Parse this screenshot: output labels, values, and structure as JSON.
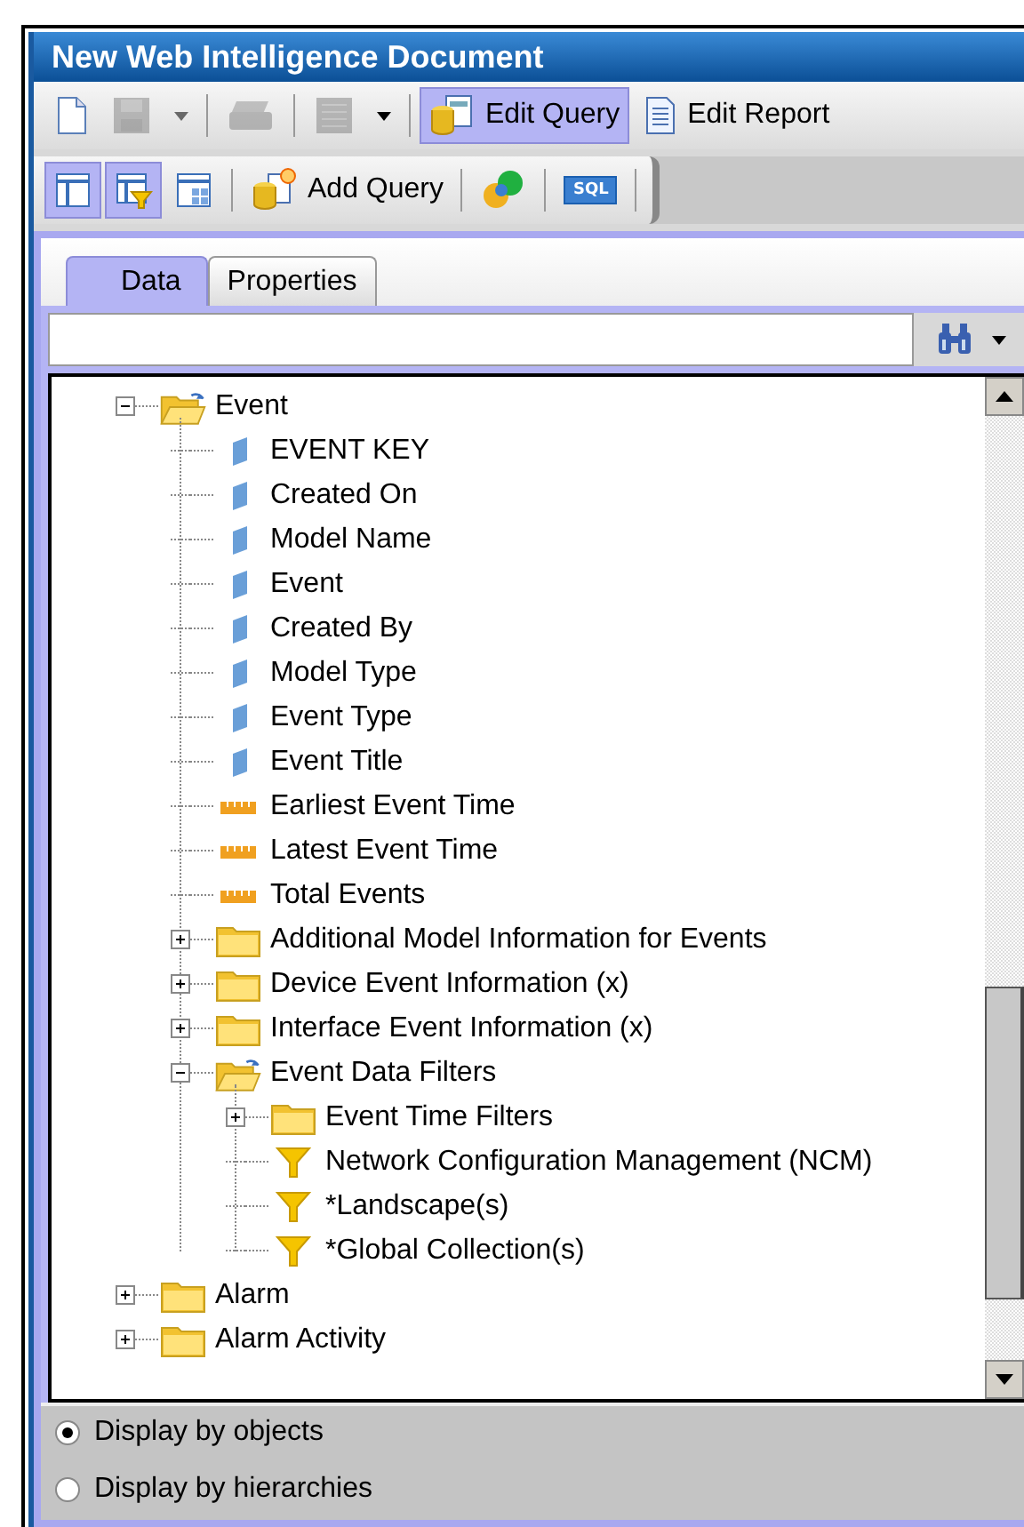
{
  "window": {
    "title": "New Web Intelligence Document"
  },
  "toolbar_main": [
    {
      "kind": "new",
      "disabled": false
    },
    {
      "kind": "save",
      "disabled": true
    },
    {
      "kind": "caret",
      "disabled": true
    },
    {
      "kind": "sep"
    },
    {
      "kind": "print",
      "disabled": true
    },
    {
      "kind": "sep"
    },
    {
      "kind": "view",
      "disabled": true
    },
    {
      "kind": "caret",
      "disabled": false
    },
    {
      "kind": "sep"
    },
    {
      "kind": "edit-query",
      "label": "Edit Query",
      "selected": true
    },
    {
      "kind": "edit-report",
      "label": "Edit Report",
      "selected": false
    }
  ],
  "toolbar_query": [
    {
      "kind": "layout",
      "selected": true
    },
    {
      "kind": "filter-layout",
      "selected": true
    },
    {
      "kind": "grid",
      "selected": false
    },
    {
      "kind": "sep"
    },
    {
      "kind": "add-query",
      "label": "Add Query",
      "selected": false
    },
    {
      "kind": "sep"
    },
    {
      "kind": "combine",
      "selected": false
    },
    {
      "kind": "sep"
    },
    {
      "kind": "sql",
      "label": "SQL",
      "selected": false
    },
    {
      "kind": "sep"
    }
  ],
  "tabs": [
    {
      "label": "Data",
      "selected": true
    },
    {
      "label": "Properties",
      "selected": false
    }
  ],
  "tree": [
    {
      "label": "Event",
      "kind": "folder",
      "expanded": true,
      "children": [
        {
          "label": "EVENT KEY",
          "kind": "dimension"
        },
        {
          "label": "Created On",
          "kind": "dimension"
        },
        {
          "label": "Model Name",
          "kind": "dimension"
        },
        {
          "label": "Event",
          "kind": "dimension"
        },
        {
          "label": "Created By",
          "kind": "dimension"
        },
        {
          "label": "Model Type",
          "kind": "dimension"
        },
        {
          "label": "Event Type",
          "kind": "dimension"
        },
        {
          "label": "Event Title",
          "kind": "dimension"
        },
        {
          "label": "Earliest Event Time",
          "kind": "measure"
        },
        {
          "label": "Latest Event Time",
          "kind": "measure"
        },
        {
          "label": "Total Events",
          "kind": "measure"
        },
        {
          "label": "Additional Model Information for Events",
          "kind": "folder",
          "expanded": false
        },
        {
          "label": "Device Event Information (x)",
          "kind": "folder",
          "expanded": false
        },
        {
          "label": "Interface Event Information (x)",
          "kind": "folder",
          "expanded": false
        },
        {
          "label": "Event Data Filters",
          "kind": "folder",
          "expanded": true,
          "children": [
            {
              "label": "Event Time Filters",
              "kind": "folder",
              "expanded": false
            },
            {
              "label": "Network Configuration Management (NCM)",
              "kind": "filter"
            },
            {
              "label": "*Landscape(s)",
              "kind": "filter"
            },
            {
              "label": "*Global Collection(s)",
              "kind": "filter"
            }
          ]
        }
      ]
    },
    {
      "label": "Alarm",
      "kind": "folder",
      "expanded": false
    },
    {
      "label": "Alarm Activity",
      "kind": "folder",
      "expanded": false
    }
  ],
  "display_options": [
    {
      "label": "Display by objects",
      "selected": true
    },
    {
      "label": "Display by hierarchies",
      "selected": false
    }
  ]
}
